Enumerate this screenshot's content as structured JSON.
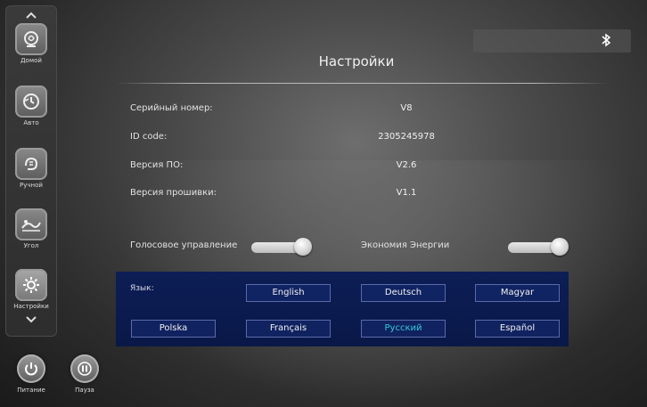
{
  "sidebar": {
    "up_arrow": "^",
    "down_arrow": "v",
    "items": [
      {
        "label": "Домой",
        "icon": "home-icon"
      },
      {
        "label": "Авто",
        "icon": "auto-icon"
      },
      {
        "label": "Ручной",
        "icon": "manual-hand-icon"
      },
      {
        "label": "Угол",
        "icon": "angle-icon"
      },
      {
        "label": "Настройки",
        "icon": "settings-gear-icon",
        "active": true
      }
    ]
  },
  "bottom_buttons": {
    "power_label": "Питание",
    "pause_label": "Пауза"
  },
  "header": {
    "title": "Настройки",
    "bluetooth_icon": "bluetooth-icon"
  },
  "info": [
    {
      "label": "Серийный номер:",
      "value": "V8"
    },
    {
      "label": "ID code:",
      "value": "2305245978"
    },
    {
      "label": "Версия ПО:",
      "value": "V2.6"
    },
    {
      "label": "Версия прошивки:",
      "value": "V1.1"
    }
  ],
  "toggles": {
    "voice_label": "Голосовое управление",
    "voice_on": true,
    "energy_label": "Экономия Энергии",
    "energy_on": true
  },
  "language": {
    "label": "Язык:",
    "options": [
      "English",
      "Deutsch",
      "Magyar",
      "Polska",
      "Français",
      "Русский",
      "Español"
    ],
    "selected": "Русский",
    "selected_color": "#35c9e0"
  }
}
